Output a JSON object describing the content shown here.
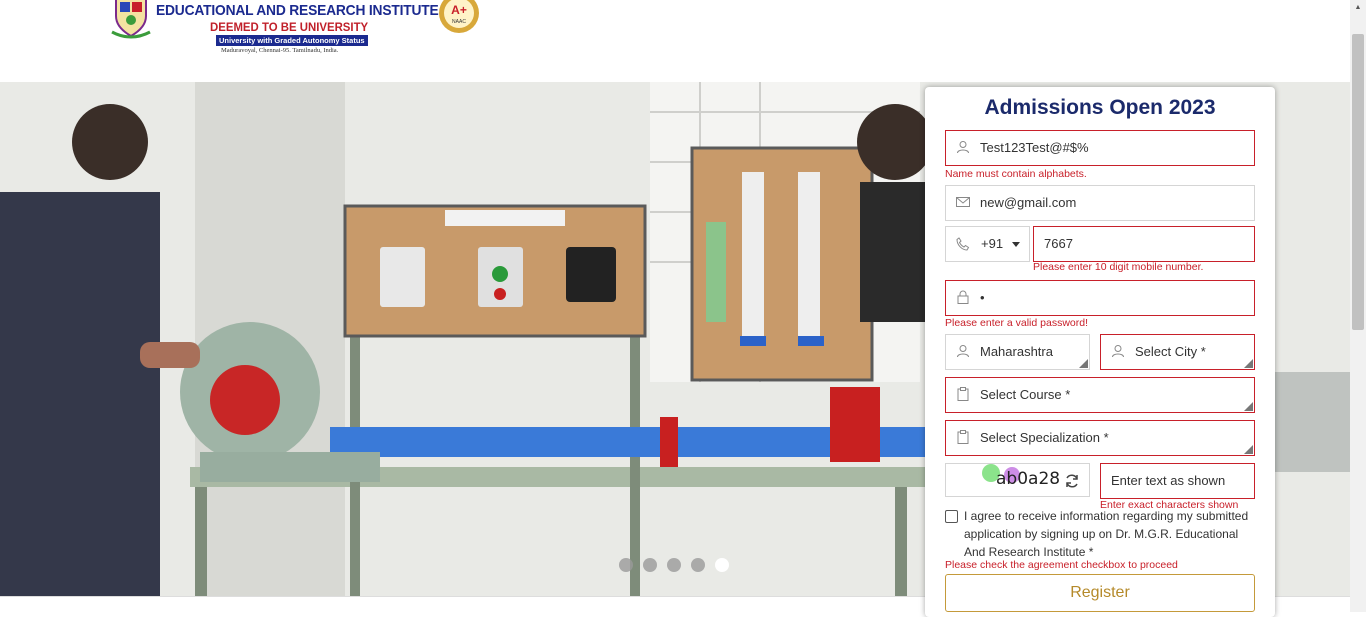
{
  "header": {
    "institute_line1": "EDUCATIONAL AND RESEARCH INSTITUTE",
    "institute_line2": "DEEMED TO BE UNIVERSITY",
    "institute_line3": "University with Graded Autonomy Status",
    "institute_line4": "Maduravoyal, Chennai-95. Tamilnadu, India.",
    "naac_grade": "A+",
    "naac_label": "NAAC"
  },
  "slider": {
    "dot_count": 5,
    "active_index": 4
  },
  "form": {
    "title": "Admissions Open 2023",
    "name_value": "Test123Test@#$%",
    "name_error": "Name must contain alphabets.",
    "email_value": "new@gmail.com",
    "country_code": "+91",
    "mobile_value": "7667",
    "mobile_error": "Please enter 10 digit mobile number.",
    "password_value": "•",
    "password_error": "Please enter a valid password!",
    "state_value": "Maharashtra",
    "city_placeholder": "Select City *",
    "course_placeholder": "Select Course *",
    "specialization_placeholder": "Select Specialization *",
    "captcha_text": "ab0a28",
    "captcha_placeholder": "Enter text as shown",
    "captcha_error": "Enter exact characters shown",
    "agree_text": "I agree to receive information regarding my submitted application by signing up on Dr. M.G.R. Educational And Research Institute *",
    "agree_error": "Please check the agreement checkbox to proceed",
    "register_label": "Register"
  },
  "colors": {
    "title": "#1b2a6b",
    "error": "#c8202a",
    "register": "#b58a2a"
  }
}
